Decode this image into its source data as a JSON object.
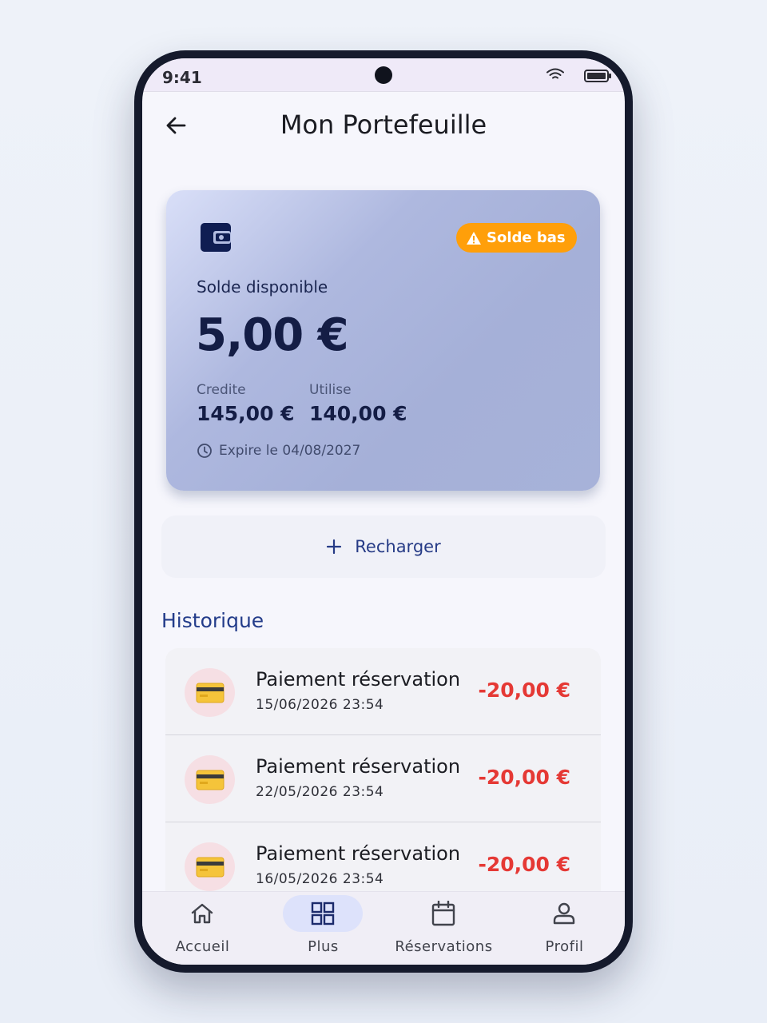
{
  "status_bar": {
    "time": "9:41"
  },
  "app_bar": {
    "title": "Mon Portefeuille"
  },
  "wallet": {
    "badge": "Solde bas",
    "available_label": "Solde disponible",
    "available_amount": "5,00 €",
    "credited_label": "Credite",
    "credited_value": "145,00 €",
    "used_label": "Utilise",
    "used_value": "140,00 €",
    "expiry": "Expire le 04/08/2027"
  },
  "recharge_label": "Recharger",
  "history": {
    "title": "Historique",
    "items": [
      {
        "title": "Paiement réservation",
        "date": "15/06/2026 23:54",
        "amount": "-20,00 €"
      },
      {
        "title": "Paiement réservation",
        "date": "22/05/2026 23:54",
        "amount": "-20,00 €"
      },
      {
        "title": "Paiement réservation",
        "date": "16/05/2026 23:54",
        "amount": "-20,00 €"
      }
    ]
  },
  "nav": {
    "items": [
      {
        "label": "Accueil",
        "icon": "home-icon"
      },
      {
        "label": "Plus",
        "icon": "grid-icon",
        "active": true
      },
      {
        "label": "Réservations",
        "icon": "calendar-icon"
      },
      {
        "label": "Profil",
        "icon": "person-icon"
      }
    ]
  },
  "colors": {
    "accent": "#233c8a",
    "warning": "#ff9f0a",
    "negative": "#e53935",
    "active_nav": "#dde2fb"
  }
}
